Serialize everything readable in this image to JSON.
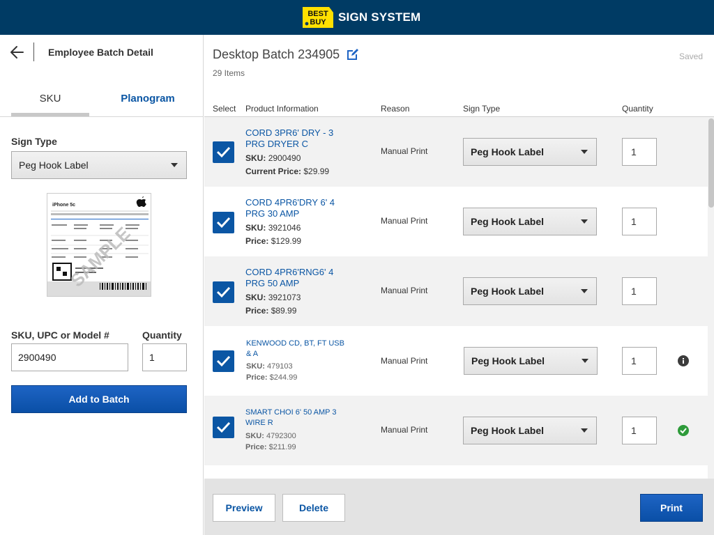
{
  "header": {
    "logo_text": "BEST BUY",
    "title": "SIGN SYSTEM"
  },
  "left_panel": {
    "title": "Employee Batch Detail",
    "tabs": [
      {
        "label": "SKU",
        "active": true
      },
      {
        "label": "Planogram",
        "active": false
      }
    ],
    "sign_type_label": "Sign Type",
    "sign_type_value": "Peg Hook Label",
    "preview_image": {
      "product": "iPhone 5c",
      "watermark": "SAMPLE"
    },
    "sku_label": "SKU, UPC or Model #",
    "sku_value": "2900490",
    "quantity_label": "Quantity",
    "quantity_value": "1",
    "add_button": "Add to Batch"
  },
  "batch": {
    "title": "Desktop Batch 234905",
    "items_count": "29 Items",
    "save_status": "Saved"
  },
  "table": {
    "columns": [
      "Select",
      "Product Information",
      "Reason",
      "Sign Type",
      "Quantity"
    ],
    "rows": [
      {
        "name": "CORD 3PR6' DRY - 3 PRG DRYER C",
        "sku_label": "SKU:",
        "sku": "2900490",
        "price_label": "Current Price:",
        "price": "$29.99",
        "reason": "Manual Print",
        "sign_type": "Peg Hook Label",
        "quantity": "1",
        "checked": true,
        "status": ""
      },
      {
        "name": "CORD 4PR6'DRY 6' 4 PRG 30 AMP",
        "sku_label": "SKU:",
        "sku": "3921046",
        "price_label": "Price:",
        "price": "$129.99",
        "reason": "Manual Print",
        "sign_type": "Peg Hook Label",
        "quantity": "1",
        "checked": true,
        "status": ""
      },
      {
        "name": "CORD 4PR6'RNG6' 4 PRG 50 AMP",
        "sku_label": "SKU:",
        "sku": "3921073",
        "price_label": "Price:",
        "price": "$89.99",
        "reason": "Manual Print",
        "sign_type": "Peg Hook Label",
        "quantity": "1",
        "checked": true,
        "status": ""
      },
      {
        "name": "KENWOOD CD, BT, FT USB & A",
        "sku_label": "SKU:",
        "sku": "479103",
        "price_label": "Price:",
        "price": "$244.99",
        "reason": "Manual Print",
        "sign_type": "Peg Hook Label",
        "quantity": "1",
        "checked": true,
        "status": "info"
      },
      {
        "name": "SMART CHOI 6' 50 AMP 3 WIRE R",
        "sku_label": "SKU:",
        "sku": "4792300",
        "price_label": "Price:",
        "price": "$211.99",
        "reason": "Manual Print",
        "sign_type": "Peg Hook Label",
        "quantity": "1",
        "checked": true,
        "status": "success"
      }
    ]
  },
  "footer": {
    "preview_button": "Preview",
    "delete_button": "Delete",
    "print_button": "Print"
  },
  "colors": {
    "header_bg": "#003b64",
    "brand_yellow": "#ffe000",
    "link_blue": "#0b56a4",
    "primary_button": "#0a4fa6",
    "success_green": "#2e9b3a",
    "info_gray": "#3c3c3c"
  },
  "icons": {
    "back": "arrow-left-icon",
    "edit": "edit-pencil-icon",
    "checkbox": "checkmark-icon",
    "dropdown": "caret-down-icon",
    "info": "info-circle-icon",
    "success": "check-circle-icon"
  }
}
